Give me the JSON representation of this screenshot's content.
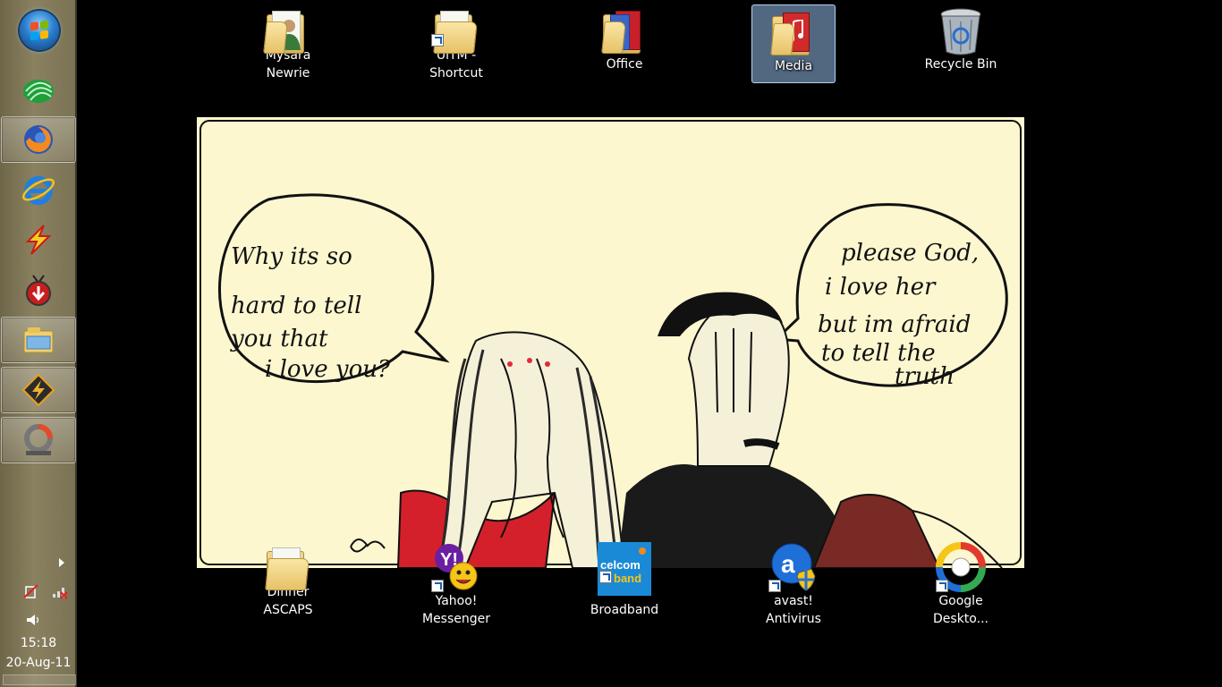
{
  "taskbar": {
    "pinned": [
      {
        "id": "start",
        "icon": "windows-start-orb-icon"
      },
      {
        "id": "app-green",
        "icon": "green-leaf-app-icon"
      },
      {
        "id": "firefox",
        "icon": "firefox-icon",
        "active": true
      },
      {
        "id": "ie",
        "icon": "internet-explorer-icon"
      },
      {
        "id": "flashget",
        "icon": "lightning-bolt-icon"
      },
      {
        "id": "download",
        "icon": "download-tv-icon"
      },
      {
        "id": "explorer",
        "icon": "windows-explorer-icon",
        "active": true
      },
      {
        "id": "winamp",
        "icon": "winamp-icon",
        "active": true
      },
      {
        "id": "photoscape",
        "icon": "photoscape-icon",
        "active": true
      }
    ],
    "tray": {
      "time": "15:18",
      "date": "20-Aug-11",
      "icons": [
        "power-icon",
        "network-icon",
        "volume-icon"
      ]
    }
  },
  "desktop": {
    "icons": [
      {
        "label": "Mysara\nNewrie",
        "line1": "Mysara",
        "line2": "Newrie",
        "type": "user-folder",
        "selected": false,
        "shortcut": false
      },
      {
        "label": "UiTM - Shortcut",
        "line1": "UiTM -",
        "line2": "Shortcut",
        "type": "folder",
        "selected": false,
        "shortcut": true
      },
      {
        "label": "Office",
        "line1": "Office",
        "line2": "",
        "type": "office-folder",
        "selected": false,
        "shortcut": false
      },
      {
        "label": "Media",
        "line1": "Media",
        "line2": "",
        "type": "media-folder",
        "selected": true,
        "shortcut": false
      },
      {
        "label": "Recycle Bin",
        "line1": "Recycle Bin",
        "line2": "",
        "type": "recycle-bin",
        "selected": false,
        "shortcut": false
      },
      {
        "label": "Dinner ASCAPS",
        "line1": "Dinner",
        "line2": "ASCAPS",
        "type": "folder",
        "selected": false,
        "shortcut": false
      },
      {
        "label": "Yahoo! Messenger",
        "line1": "Yahoo!",
        "line2": "Messenger",
        "type": "yahoo",
        "selected": false,
        "shortcut": true
      },
      {
        "label": "Celcom Broadband",
        "line1": "Celcom",
        "line2": "Broadband",
        "type": "celcom",
        "selected": false,
        "shortcut": true
      },
      {
        "label": "avast! Antivirus",
        "line1": "avast!",
        "line2": "Antivirus",
        "type": "avast",
        "selected": false,
        "shortcut": true
      },
      {
        "label": "Google Deskto...",
        "line1": "Google",
        "line2": "Deskto...",
        "type": "google",
        "selected": false,
        "shortcut": true
      }
    ]
  },
  "wallpaper": {
    "bubble_left": [
      "Why its so",
      "hard to tell",
      "you that",
      "i love you?"
    ],
    "bubble_right": [
      "please God,",
      "i love her",
      "but im afraid",
      "to tell the",
      "truth"
    ],
    "celcom_text": [
      "celcom",
      "band"
    ],
    "yahoo_text": "Y!",
    "avast_text": "a"
  },
  "colors": {
    "taskbar": "#8a8160",
    "wallpaper_bg": "#fcf7cf",
    "selection": "#96bee8"
  }
}
